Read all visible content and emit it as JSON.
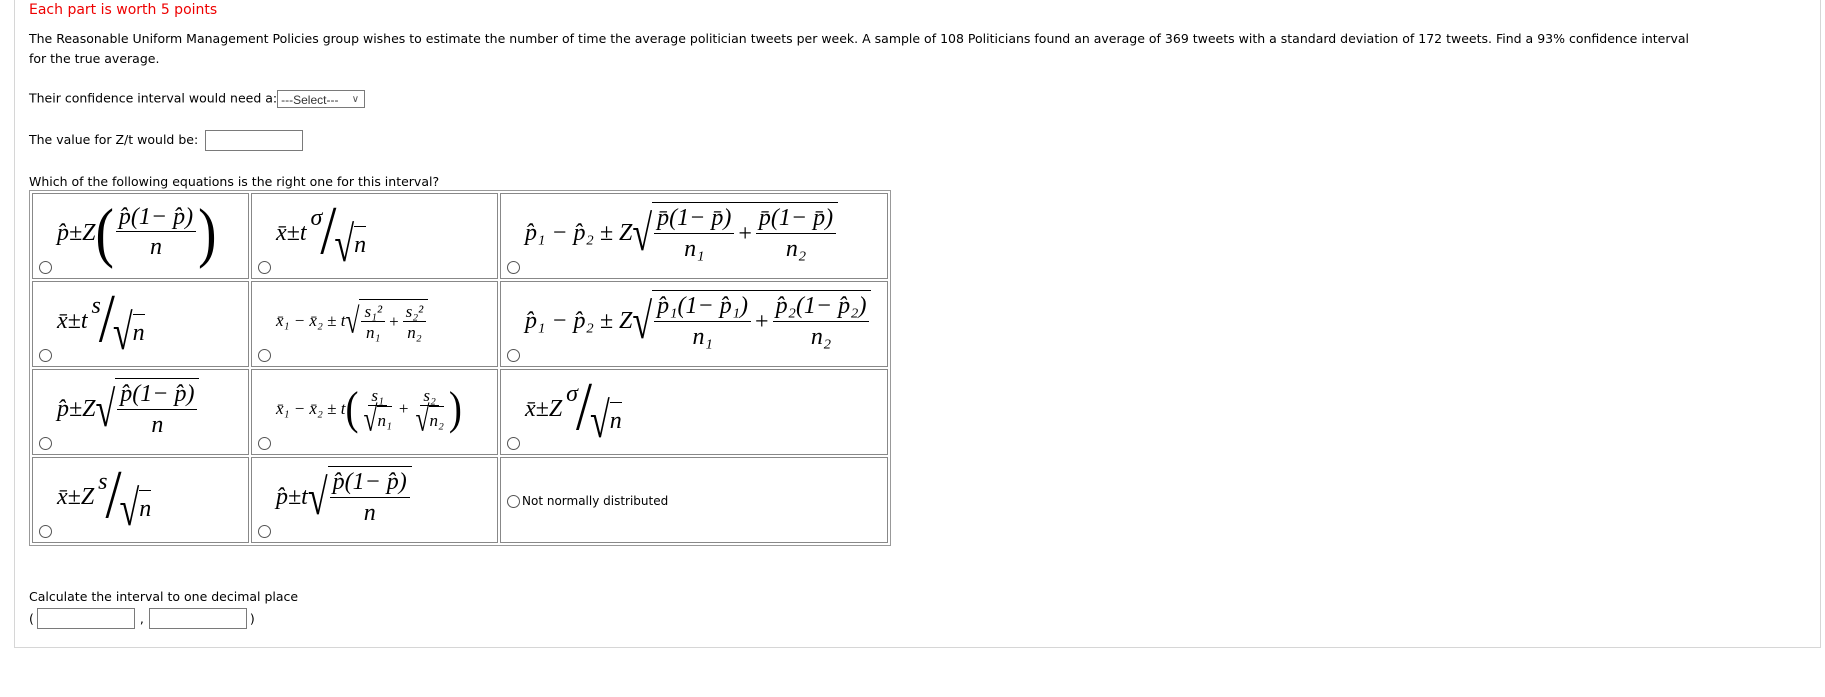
{
  "header": {
    "points_note": "Each part is worth 5 points"
  },
  "question": {
    "text_line1": "The Reasonable Uniform Management Policies group wishes to estimate the number of time the average politician tweets per week. A sample of 108 Politicians found an average of 369 tweets with a standard deviation of 172 tweets. Find a 93% confidence interval",
    "text_line2": "for the true average."
  },
  "interval_type": {
    "label": "Their confidence interval would need a:",
    "selected": "---Select---",
    "icon": "chevron-down-icon"
  },
  "zt_value": {
    "label": "The value for Z/t would be:",
    "value": ""
  },
  "equations": {
    "prompt": "Which of the following equations is the right one for this interval?",
    "options": [
      {
        "type": "paren_frac",
        "prefix": "p̂±Z",
        "num": "p̂(1− p̂)",
        "den": "n"
      },
      {
        "type": "slash",
        "prefix": "x̄±t",
        "num": "σ",
        "den": "n"
      },
      {
        "type": "sqrt_sum",
        "prefix": "p̂₁ − p̂₂ ± Z",
        "terms": [
          {
            "num": "p̄(1− p̄)",
            "den": "n₁"
          },
          {
            "num": "p̄(1− p̄)",
            "den": "n₂"
          }
        ]
      },
      {
        "type": "slash",
        "prefix": "x̄±t",
        "num": "s",
        "den": "n"
      },
      {
        "type": "sqrt_sum",
        "small": true,
        "prefix": "x̄₁ − x̄₂ ± t",
        "terms": [
          {
            "num": "s₁²",
            "den": "n₁"
          },
          {
            "num": "s₂²",
            "den": "n₂"
          }
        ]
      },
      {
        "type": "sqrt_sum",
        "prefix": "p̂₁ − p̂₂ ± Z",
        "terms": [
          {
            "num": "p̂₁(1− p̂₁)",
            "den": "n₁"
          },
          {
            "num": "p̂₂(1− p̂₂)",
            "den": "n₂"
          }
        ]
      },
      {
        "type": "sqrt_frac",
        "prefix": "p̂±Z",
        "num": "p̂(1− p̂)",
        "den": "n"
      },
      {
        "type": "paren_sum_sqrt",
        "small": true,
        "prefix": "x̄₁ − x̄₂ ± t",
        "terms": [
          {
            "num": "s₁",
            "den": "n₁"
          },
          {
            "num": "s₂",
            "den": "n₂"
          }
        ]
      },
      {
        "type": "slash",
        "prefix": "x̄±Z",
        "num": "σ",
        "den": "n"
      },
      {
        "type": "slash",
        "prefix": "x̄±Z",
        "num": "s",
        "den": "n"
      },
      {
        "type": "sqrt_frac",
        "prefix": "p̂±t",
        "num": "p̂(1− p̂)",
        "den": "n"
      },
      {
        "type": "text",
        "label": "Not normally distributed"
      }
    ]
  },
  "interval": {
    "label": "Calculate the interval to one decimal place",
    "open": "(",
    "separator": ",",
    "close": ")",
    "lower": "",
    "upper": ""
  }
}
